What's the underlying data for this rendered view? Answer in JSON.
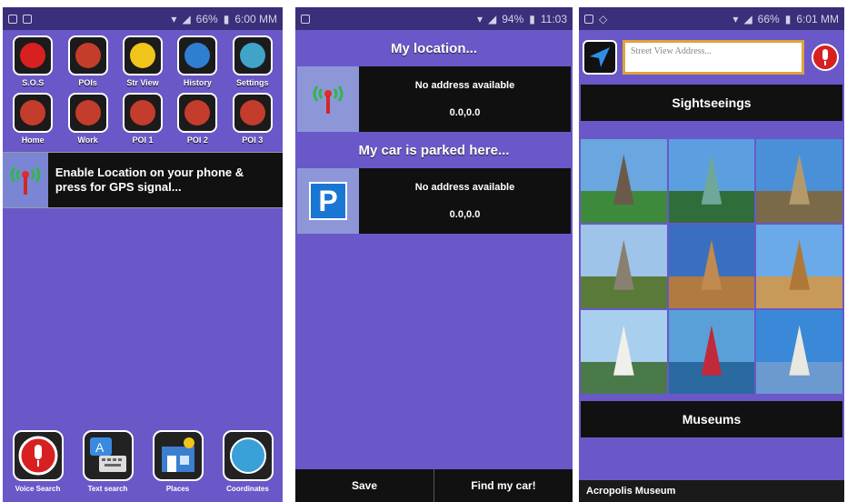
{
  "screen1": {
    "status_time": "6:00 MM",
    "status_battery": "66%",
    "tiles_row1": [
      {
        "label": "S.O.S",
        "icon": "sos-icon",
        "color": "#d82020"
      },
      {
        "label": "POIs",
        "icon": "poi-pin-icon",
        "color": "#c43c2c"
      },
      {
        "label": "Str View",
        "icon": "street-view-icon",
        "color": "#f0c419"
      },
      {
        "label": "History",
        "icon": "history-icon",
        "color": "#2f7fd1"
      },
      {
        "label": "Settings",
        "icon": "settings-gears-icon",
        "color": "#3fa4c8"
      }
    ],
    "tiles_row2": [
      {
        "label": "Home",
        "icon": "home-pin-icon",
        "color": "#c43c2c"
      },
      {
        "label": "Work",
        "icon": "work-pin-icon",
        "color": "#c43c2c"
      },
      {
        "label": "POI 1",
        "icon": "poi1-pin-icon",
        "color": "#c43c2c"
      },
      {
        "label": "POI 2",
        "icon": "poi2-pin-icon",
        "color": "#c43c2c"
      },
      {
        "label": "POI 3",
        "icon": "poi3-pin-icon",
        "color": "#c43c2c"
      }
    ],
    "enable_text": "Enable Location on your phone & press for GPS signal...",
    "bottom": [
      {
        "label": "Voice Search",
        "icon": "microphone-icon"
      },
      {
        "label": "Text search",
        "icon": "keyboard-icon"
      },
      {
        "label": "Places",
        "icon": "places-map-icon"
      },
      {
        "label": "Coordinates",
        "icon": "compass-icon"
      }
    ]
  },
  "screen2": {
    "status_time": "11:03",
    "status_battery": "94%",
    "my_location_header": "My location...",
    "location_address": "No address available",
    "location_coords": "0.0,0.0",
    "car_header": "My car is parked here...",
    "car_address": "No address available",
    "car_coords": "0.0,0.0",
    "parking_letter": "P",
    "save_label": "Save",
    "find_label": "Find my car!"
  },
  "screen3": {
    "status_time": "6:01 MM",
    "status_battery": "66%",
    "address_placeholder": "Street View Address...",
    "sightseeings_label": "Sightseeings",
    "photos": [
      {
        "name": "eiffel-tower-photo",
        "sky": "#6aa6e0",
        "ground": "#3d8a3d",
        "subject": "#6b5a4a"
      },
      {
        "name": "statue-of-liberty-photo",
        "sky": "#5b9fe0",
        "ground": "#2f6e3a",
        "subject": "#6fa89a"
      },
      {
        "name": "big-ben-photo",
        "sky": "#4a90d8",
        "ground": "#7a6a4a",
        "subject": "#b49a6a"
      },
      {
        "name": "chichen-itza-photo",
        "sky": "#9ec4ea",
        "ground": "#5a7a3a",
        "subject": "#8a8070"
      },
      {
        "name": "colosseum-photo",
        "sky": "#3a6fc0",
        "ground": "#b07a40",
        "subject": "#c08a50"
      },
      {
        "name": "pyramid-photo",
        "sky": "#6aaae8",
        "ground": "#c89a5a",
        "subject": "#b07838"
      },
      {
        "name": "taj-mahal-photo",
        "sky": "#a8cfee",
        "ground": "#4a7a4a",
        "subject": "#f0f0ea"
      },
      {
        "name": "venice-gondola-photo",
        "sky": "#5aa0d8",
        "ground": "#2a6aa0",
        "subject": "#c02a3a"
      },
      {
        "name": "christ-redeemer-photo",
        "sky": "#3a88d8",
        "ground": "#6a9ad0",
        "subject": "#e8e8e0"
      }
    ],
    "museums_label": "Museums",
    "museum_item": "Acropolis Museum"
  }
}
